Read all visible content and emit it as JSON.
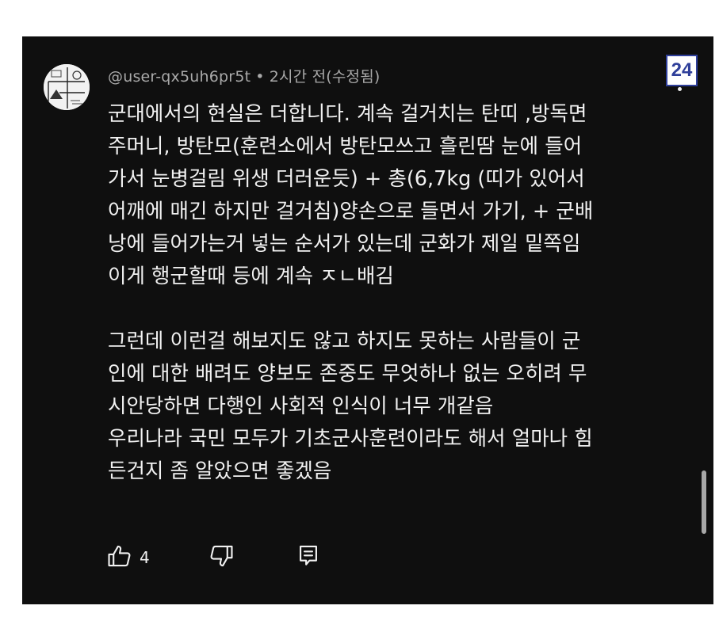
{
  "comment": {
    "author": "@user-qx5uh6pr5t",
    "separator": "•",
    "timestamp": "2시간 전(수정됨)",
    "text": "군대에서의 현실은 더합니다. 계속 걸거치는 탄띠 ,방독면\n주머니, 방탄모(훈련소에서 방탄모쓰고 흘린땀 눈에 들어\n가서 눈병걸림 위생 더러운듯) + 총(6,7kg (띠가 있어서\n어깨에 매긴 하지만 걸거침)양손으로 들면서 가기,  + 군배\n낭에 들어가는거 넣는 순서가 있는데 군화가 제일 밑쪽임\n이게 행군할때 등에 계속 ㅈㄴ배김\n\n그런데 이런걸 해보지도 않고 하지도 못하는 사람들이 군\n인에 대한 배려도 양보도 존중도 무엇하나 없는 오히려 무\n시안당하면 다행인 사회적 인식이 너무 개같음\n우리나라 국민 모두가 기초군사훈련이라도 해서 얼마나 힘\n든건지 좀 알았으면 좋겠음",
    "like_count": "4",
    "icons": {
      "like": "thumbs-up-icon",
      "dislike": "thumbs-down-icon",
      "reply": "reply-comment-icon",
      "more": "more-vert-icon"
    }
  },
  "badge": {
    "number": "24"
  },
  "colors": {
    "background": "#0f0f0f",
    "text_primary": "#f1f1f1",
    "text_secondary": "#aaaaaa",
    "badge_border": "#2f3f9a"
  }
}
